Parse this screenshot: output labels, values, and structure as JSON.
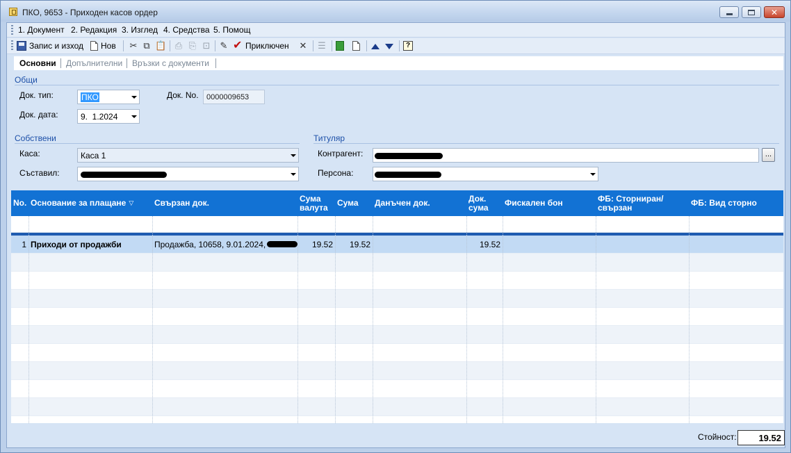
{
  "window": {
    "title": "ПКО, 9653 - Приходен касов ордер"
  },
  "menu": [
    {
      "label": "1. Документ"
    },
    {
      "label": "2. Редакция"
    },
    {
      "label": "3. Изглед"
    },
    {
      "label": "4. Средства"
    },
    {
      "label": "5. Помощ"
    }
  ],
  "toolbar": {
    "save_label": "Запис и изход",
    "new_label": "Нов",
    "close_doc_label": "Приключен"
  },
  "tabs": [
    {
      "label": "Основни",
      "active": true
    },
    {
      "label": "Допълнителни",
      "active": false
    },
    {
      "label": "Връзки с документи",
      "active": false
    }
  ],
  "general": {
    "group_label": "Общи",
    "doc_type_label": "Док. тип:",
    "doc_type_value": "ПКО",
    "doc_no_label": "Док. No.",
    "doc_no_value": "0000009653",
    "doc_date_label": "Док. дата:",
    "doc_date_value": "9.  1.2024"
  },
  "own": {
    "group_label": "Собствени",
    "cash_label": "Каса:",
    "cash_value": "Каса 1",
    "author_label": "Съставил:"
  },
  "holder": {
    "group_label": "Титуляр",
    "counterparty_label": "Контрагент:",
    "person_label": "Персона:",
    "browse_label": "..."
  },
  "grid": {
    "columns": [
      {
        "label": "No."
      },
      {
        "label": "Основание за плащане"
      },
      {
        "label": "Свързан док."
      },
      {
        "label": "Сума валута"
      },
      {
        "label": "Сума"
      },
      {
        "label": "Данъчен док."
      },
      {
        "label": "Док. сума"
      },
      {
        "label": "Фискален бон"
      },
      {
        "label": "ФБ: Сторниран/свързан"
      },
      {
        "label": "ФБ: Вид сторно"
      }
    ],
    "rows": [
      {
        "no": "1",
        "reason": "Приходи от продажби",
        "linked_doc": "Продажба, 10658, 9.01.2024,",
        "amount_currency": "19.52",
        "amount": "19.52",
        "tax_doc": "",
        "doc_amount": "19.52",
        "fiscal_receipt": "",
        "fb_storno": "",
        "fb_storno_type": ""
      }
    ]
  },
  "footer": {
    "total_label": "Стойност:",
    "total_value": "19.52"
  },
  "colors": {
    "grid_header": "#1272d4",
    "selected_row": "#c2daf4",
    "group_label": "#1c4fa8"
  }
}
